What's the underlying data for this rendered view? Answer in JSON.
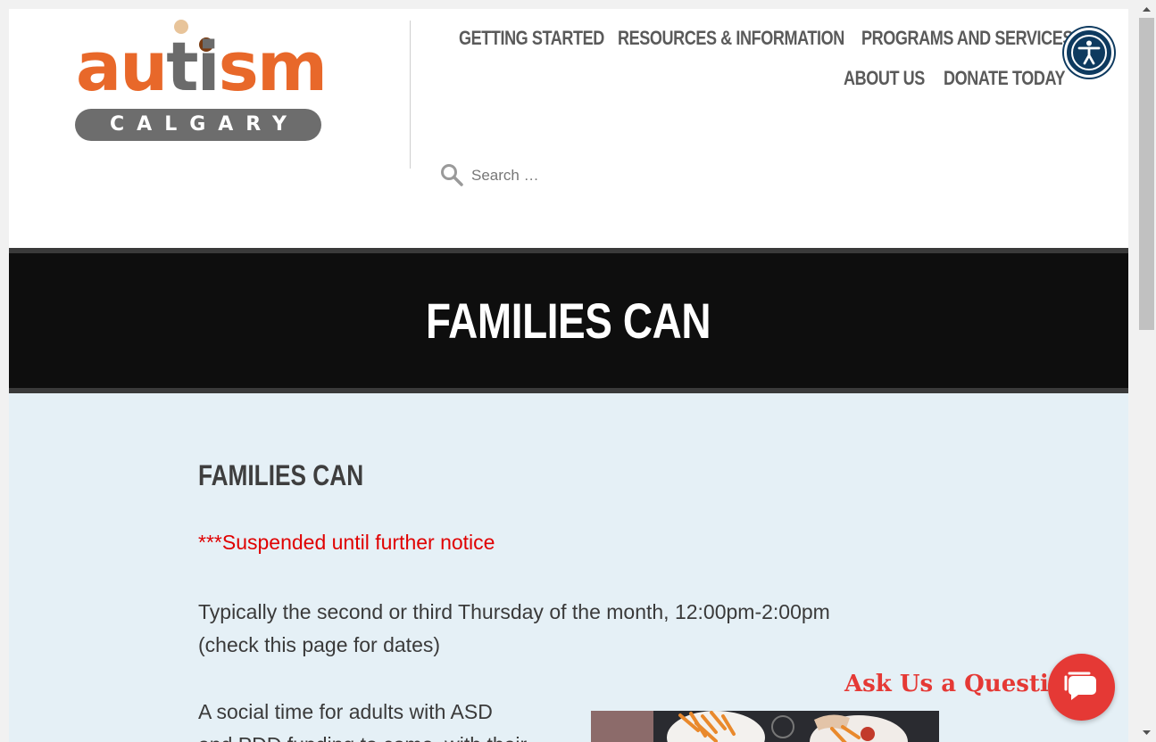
{
  "logo": {
    "word_parts": [
      "au",
      "t",
      "i",
      "sm"
    ],
    "subtitle": "CALGARY",
    "colors": {
      "orange": "#e8682a",
      "gray": "#6b6b6b",
      "tan": "#e8c49a",
      "brown": "#7a3b12"
    }
  },
  "nav": {
    "items": [
      {
        "label": "GETTING STARTED"
      },
      {
        "label": "RESOURCES & INFORMATION"
      },
      {
        "label": "PROGRAMS AND SERVICES"
      },
      {
        "label": "ABOUT US"
      },
      {
        "label": "DONATE TODAY"
      }
    ]
  },
  "search": {
    "placeholder": "Search …",
    "icon": "search-icon"
  },
  "accessibility": {
    "icon": "accessibility-person-icon",
    "color": "#0e3a5f"
  },
  "hero": {
    "title": "FAMILIES CAN"
  },
  "content": {
    "heading": "FAMILIES CAN",
    "notice": "***Suspended until further notice",
    "schedule_line1": "Typically the second or third Thursday of the month, 12:00pm-2:00pm",
    "schedule_line2": "(check this page for dates)",
    "intro_line1": "A social time for adults with ASD",
    "intro_line2": "and PDD funding to come, with their"
  },
  "chat": {
    "label": "Ask Us a Question",
    "icon": "chat-bubble-icon",
    "color": "#e53935"
  }
}
